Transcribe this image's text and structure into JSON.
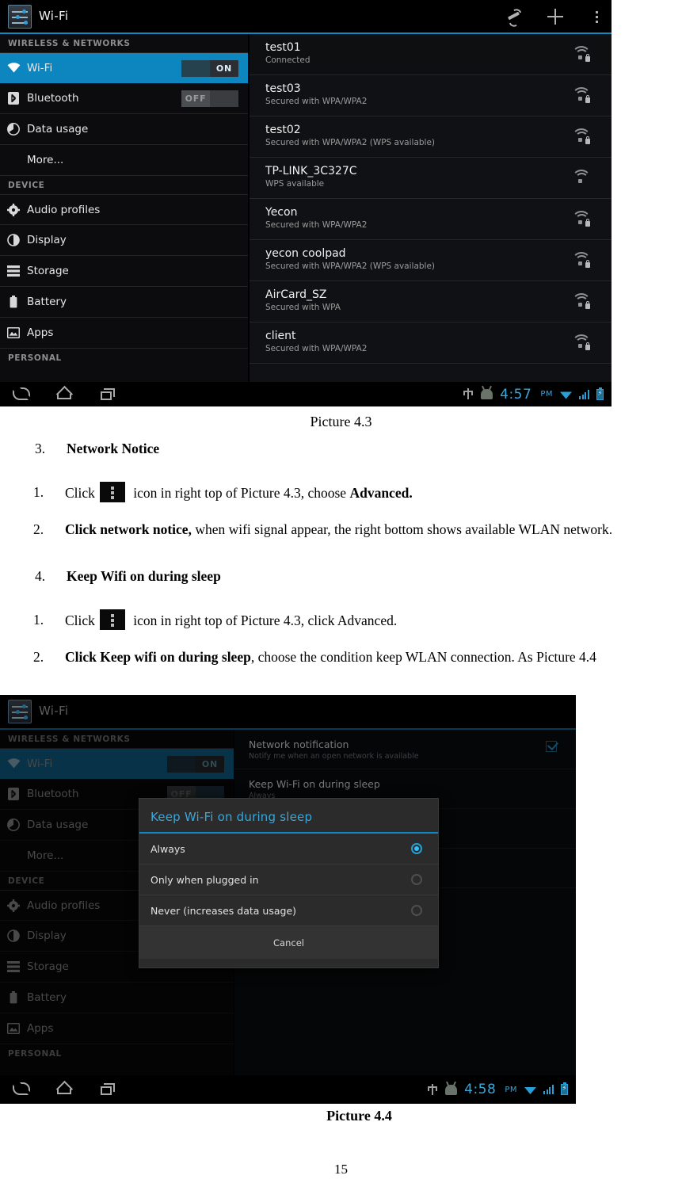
{
  "document": {
    "caption_1": "Picture 4.3",
    "caption_2": "Picture 4.4",
    "page_number": "15",
    "sections": [
      {
        "number": "3.",
        "title": "Network Notice",
        "steps": [
          {
            "number": "1.",
            "pre": "Click",
            "post": " icon in right top of Picture 4.3, choose ",
            "bold_tail": "Advanced."
          },
          {
            "number": "2.",
            "lead": "Click ",
            "bold": "network notice,",
            "rest": " when wifi signal appear, the right bottom shows available WLAN network."
          }
        ]
      },
      {
        "number": "4.",
        "title": "Keep Wifi on during sleep",
        "steps": [
          {
            "number": "1.",
            "pre": "Click",
            "post": " icon in right top of Picture 4.3, click Advanced."
          },
          {
            "number": "2.",
            "lead": "Click ",
            "bold": "Keep wifi on during sleep",
            "rest": ", choose the condition keep WLAN connection. As Picture 4.4"
          }
        ]
      }
    ]
  },
  "shot1": {
    "actionbar": {
      "title": "Wi-Fi",
      "icons": [
        "scan-icon",
        "add-icon",
        "overflow-menu-icon"
      ]
    },
    "sidebar": {
      "section_wireless": "WIRELESS & NETWORKS",
      "section_device": "DEVICE",
      "section_personal": "PERSONAL",
      "items": [
        {
          "label": "Wi-Fi",
          "icon": "wifi-icon",
          "toggle": "ON",
          "selected": true
        },
        {
          "label": "Bluetooth",
          "icon": "bluetooth-icon",
          "toggle": "OFF",
          "selected": false
        },
        {
          "label": "Data usage",
          "icon": "data-usage-icon",
          "selected": false
        },
        {
          "label": "More...",
          "icon": "",
          "selected": false
        },
        {
          "label": "Audio profiles",
          "icon": "audio-profiles-icon",
          "selected": false
        },
        {
          "label": "Display",
          "icon": "display-icon",
          "selected": false
        },
        {
          "label": "Storage",
          "icon": "storage-icon",
          "selected": false
        },
        {
          "label": "Battery",
          "icon": "battery-icon",
          "selected": false
        },
        {
          "label": "Apps",
          "icon": "apps-icon",
          "selected": false
        }
      ]
    },
    "networks": [
      {
        "ssid": "test01",
        "status": "Connected",
        "locked": true
      },
      {
        "ssid": "test03",
        "status": "Secured with WPA/WPA2",
        "locked": true
      },
      {
        "ssid": "test02",
        "status": "Secured with WPA/WPA2 (WPS available)",
        "locked": true
      },
      {
        "ssid": "TP-LINK_3C327C",
        "status": "WPS available",
        "locked": false
      },
      {
        "ssid": "Yecon",
        "status": "Secured with WPA/WPA2",
        "locked": true
      },
      {
        "ssid": "yecon coolpad",
        "status": "Secured with WPA/WPA2 (WPS available)",
        "locked": true
      },
      {
        "ssid": "AirCard_SZ",
        "status": "Secured with WPA",
        "locked": true
      },
      {
        "ssid": "client",
        "status": "Secured with WPA/WPA2",
        "locked": true
      }
    ],
    "navbar": {
      "back": "back-icon",
      "home": "home-icon",
      "recents": "recents-icon",
      "time": "4:57",
      "ampm": "PM"
    }
  },
  "shot2": {
    "actionbar": {
      "title": "Wi-Fi"
    },
    "sidebar": {
      "section_wireless": "WIRELESS & NETWORKS",
      "section_device": "DEVICE",
      "section_personal": "PERSONAL",
      "items": [
        {
          "label": "Wi-Fi",
          "icon": "wifi-icon",
          "toggle": "ON",
          "selected": true
        },
        {
          "label": "Bluetooth",
          "icon": "bluetooth-icon",
          "toggle": "OFF",
          "selected": false
        },
        {
          "label": "Data usage",
          "icon": "data-usage-icon",
          "selected": false
        },
        {
          "label": "More...",
          "icon": "",
          "selected": false
        },
        {
          "label": "Audio profiles",
          "icon": "audio-profiles-icon",
          "selected": false
        },
        {
          "label": "Display",
          "icon": "display-icon",
          "selected": false
        },
        {
          "label": "Storage",
          "icon": "storage-icon",
          "selected": false
        },
        {
          "label": "Battery",
          "icon": "battery-icon",
          "selected": false
        },
        {
          "label": "Apps",
          "icon": "apps-icon",
          "selected": false
        }
      ]
    },
    "advanced": [
      {
        "title": "Network notification",
        "subtitle": "Notify me when an open network is available",
        "checked": true
      },
      {
        "title": "Keep Wi-Fi on during sleep",
        "subtitle": "Always",
        "checked": false
      }
    ],
    "dialog": {
      "title": "Keep Wi-Fi on during sleep",
      "options": [
        {
          "label": "Always",
          "selected": true
        },
        {
          "label": "Only when plugged in",
          "selected": false
        },
        {
          "label": "Never (increases data usage)",
          "selected": false
        }
      ],
      "cancel": "Cancel"
    },
    "navbar": {
      "time": "4:58",
      "ampm": "PM"
    }
  }
}
